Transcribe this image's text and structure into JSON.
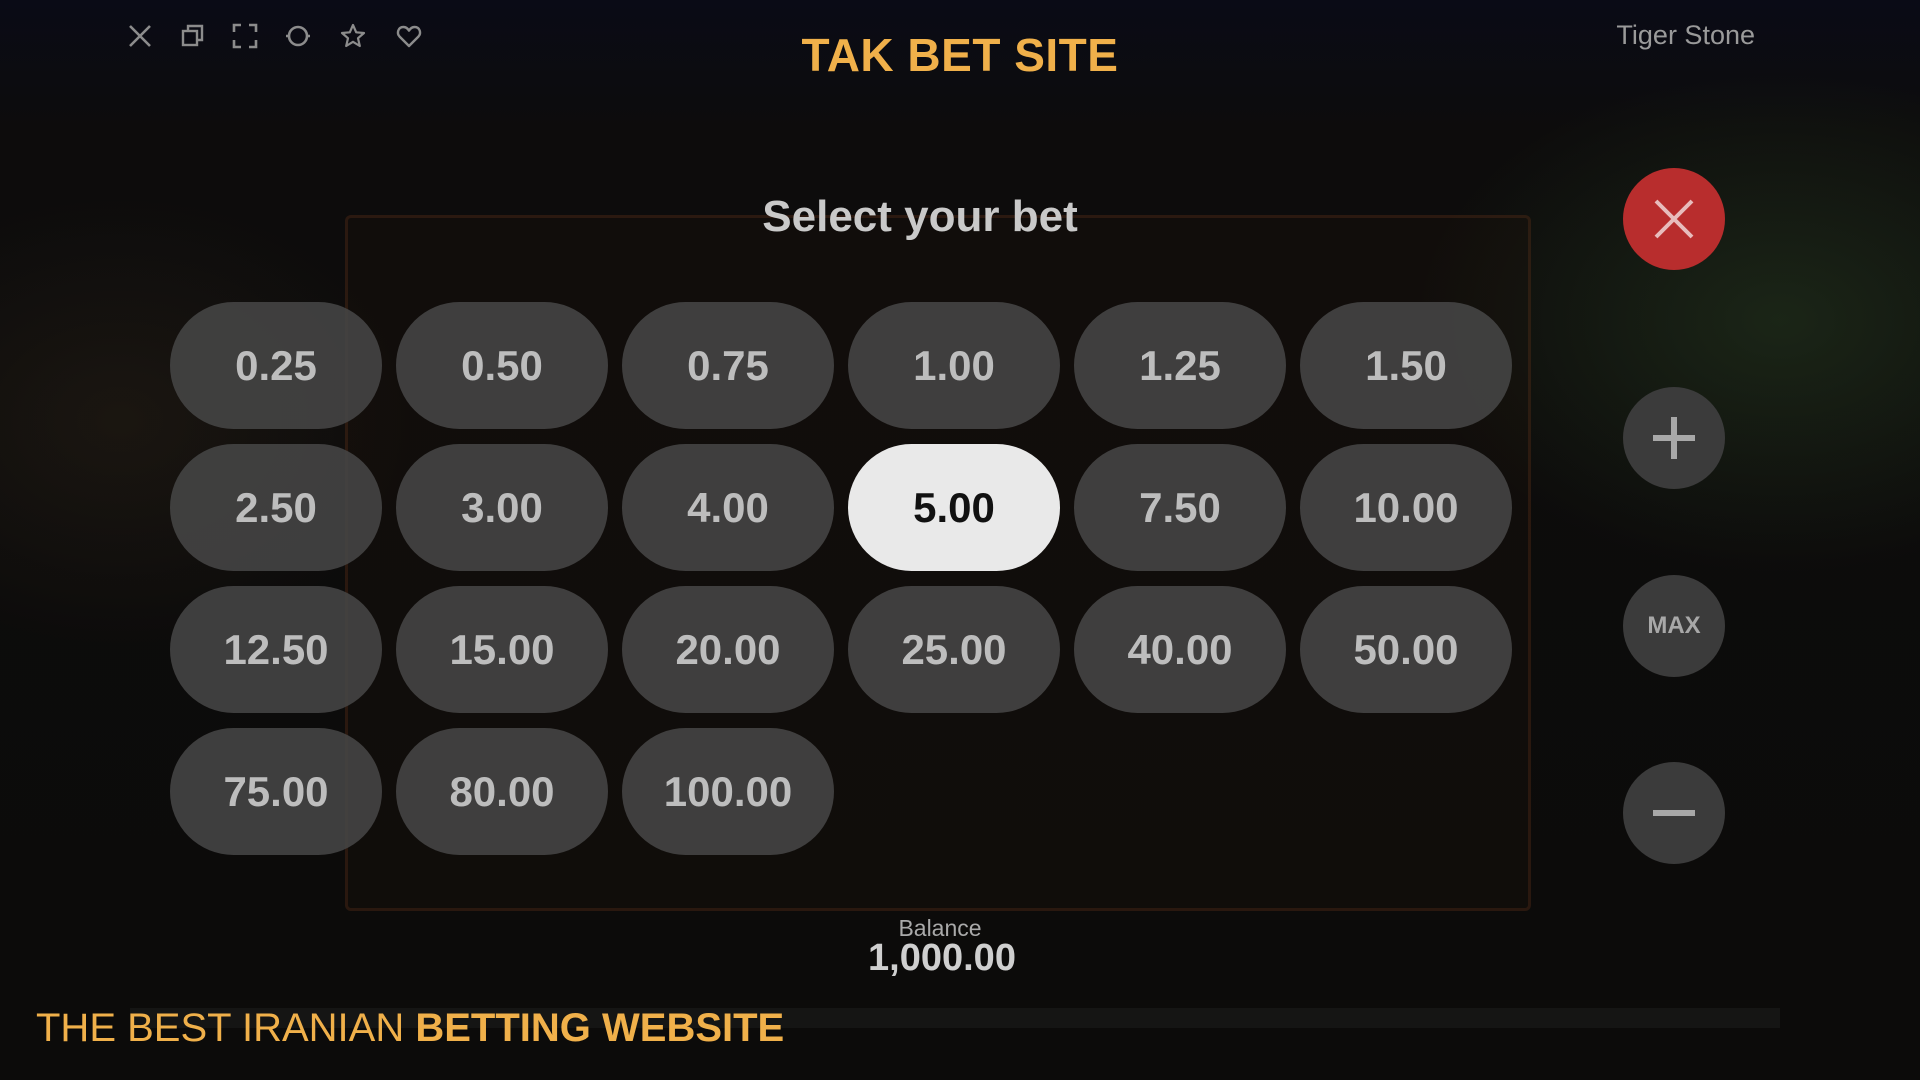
{
  "branding": {
    "site_title": "TAK BET SITE",
    "tagline_regular": "THE BEST IRANIAN ",
    "tagline_bold": "BETTING WEBSITE",
    "accent_color": "#f0b04a"
  },
  "top_bar": {
    "game_name": "Tiger Stone",
    "icons": [
      "close-icon",
      "window-restore-icon",
      "fullscreen-icon",
      "circle-icon",
      "star-icon",
      "heart-icon"
    ]
  },
  "bet_dialog": {
    "title": "Select your bet",
    "selected_value": "5.00",
    "bets": [
      "0.25",
      "0.50",
      "0.75",
      "1.00",
      "1.25",
      "1.50",
      "2.50",
      "3.00",
      "4.00",
      "5.00",
      "7.50",
      "10.00",
      "12.50",
      "15.00",
      "20.00",
      "25.00",
      "40.00",
      "50.00",
      "75.00",
      "80.00",
      "100.00"
    ],
    "side_controls": {
      "max_label": "MAX",
      "close_color": "#b82d2d"
    }
  },
  "balance": {
    "label": "Balance",
    "value": "1,000.00"
  }
}
